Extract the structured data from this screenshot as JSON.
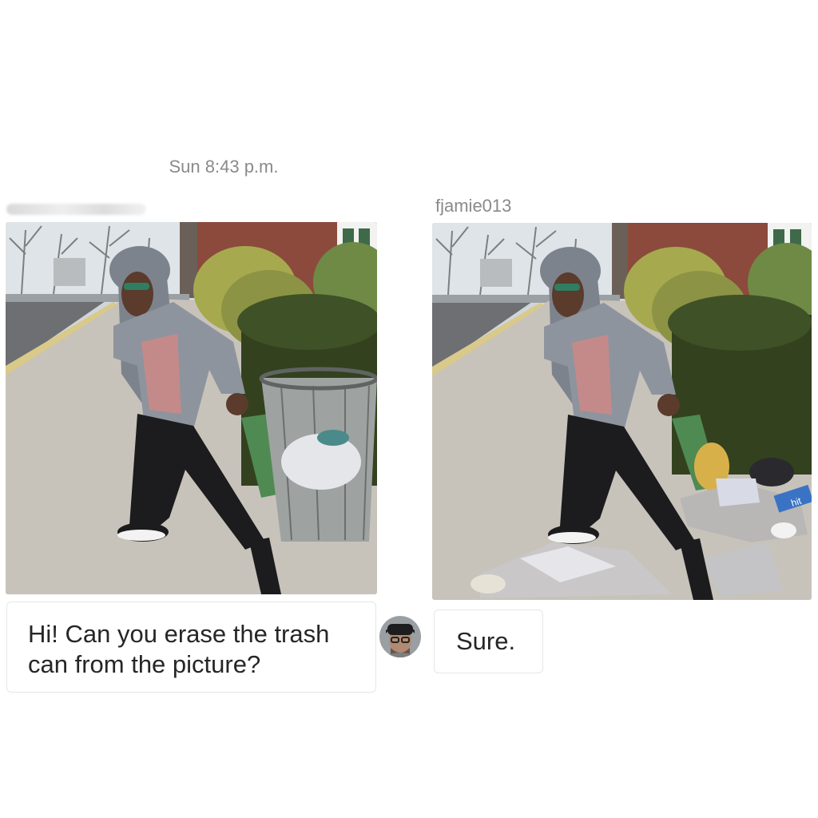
{
  "chat": {
    "timestamp": "Sun 8:43 p.m.",
    "reply_username": "fjamie013",
    "messages": [
      {
        "sender": "user",
        "text": "Hi! Can you erase the trash can from the picture?"
      },
      {
        "sender": "fjamie013",
        "text": "Sure."
      }
    ]
  },
  "images": {
    "original_photo": "photo of person posing on sidewalk next to a wire mesh trash can",
    "edited_photo": "same photo with trash can removed and litter left scattered on the sidewalk",
    "edited_photo_visible_text": "hit"
  },
  "colors": {
    "text": "#262626",
    "meta_text": "#8a8a8a",
    "bubble_border": "#e6e6e6",
    "background": "#ffffff"
  }
}
